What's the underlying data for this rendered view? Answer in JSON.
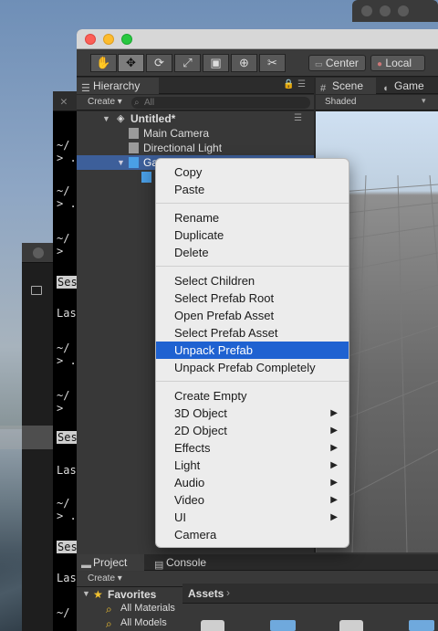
{
  "unity_window": {
    "toolbar": {
      "tools": [
        "hand-tool",
        "move-tool",
        "rotate-tool",
        "scale-tool",
        "rect-tool",
        "transform-tool",
        "custom-tool"
      ],
      "pivot_label": "Center",
      "space_label": "Local"
    },
    "hierarchy": {
      "tab_label": "Hierarchy",
      "create_label": "Create",
      "search_placeholder": "All",
      "scene_name": "Untitled*",
      "items": [
        {
          "label": "Main Camera"
        },
        {
          "label": "Directional Light"
        },
        {
          "label": "GameObject"
        }
      ]
    },
    "scene_tabs": {
      "scene_label": "Scene",
      "game_label": "Game",
      "shaded_label": "Shaded"
    },
    "project": {
      "project_tab": "Project",
      "console_tab": "Console",
      "create_label": "Create",
      "favorites_label": "Favorites",
      "favorites_items": [
        "All Materials",
        "All Models"
      ],
      "assets_label": "Assets"
    }
  },
  "terminal": {
    "lines": [
      "~/",
      "> .",
      "~/",
      "> .",
      "~/",
      "> ",
      "Ses",
      "Las",
      "~/",
      "> .",
      "~/",
      "> ",
      "Ses",
      "Las",
      "~/",
      "> .",
      "Ses",
      "Las",
      "~/"
    ]
  },
  "context_menu": {
    "groups": [
      [
        {
          "label": "Copy"
        },
        {
          "label": "Paste"
        }
      ],
      [
        {
          "label": "Rename"
        },
        {
          "label": "Duplicate"
        },
        {
          "label": "Delete"
        }
      ],
      [
        {
          "label": "Select Children"
        },
        {
          "label": "Select Prefab Root"
        },
        {
          "label": "Open Prefab Asset"
        },
        {
          "label": "Select Prefab Asset"
        },
        {
          "label": "Unpack Prefab",
          "highlighted": true
        },
        {
          "label": "Unpack Prefab Completely"
        }
      ],
      [
        {
          "label": "Create Empty"
        },
        {
          "label": "3D Object",
          "submenu": true
        },
        {
          "label": "2D Object",
          "submenu": true
        },
        {
          "label": "Effects",
          "submenu": true
        },
        {
          "label": "Light",
          "submenu": true
        },
        {
          "label": "Audio",
          "submenu": true
        },
        {
          "label": "Video",
          "submenu": true
        },
        {
          "label": "UI",
          "submenu": true
        },
        {
          "label": "Camera"
        }
      ]
    ],
    "highlight_color": "#1f62d1"
  }
}
